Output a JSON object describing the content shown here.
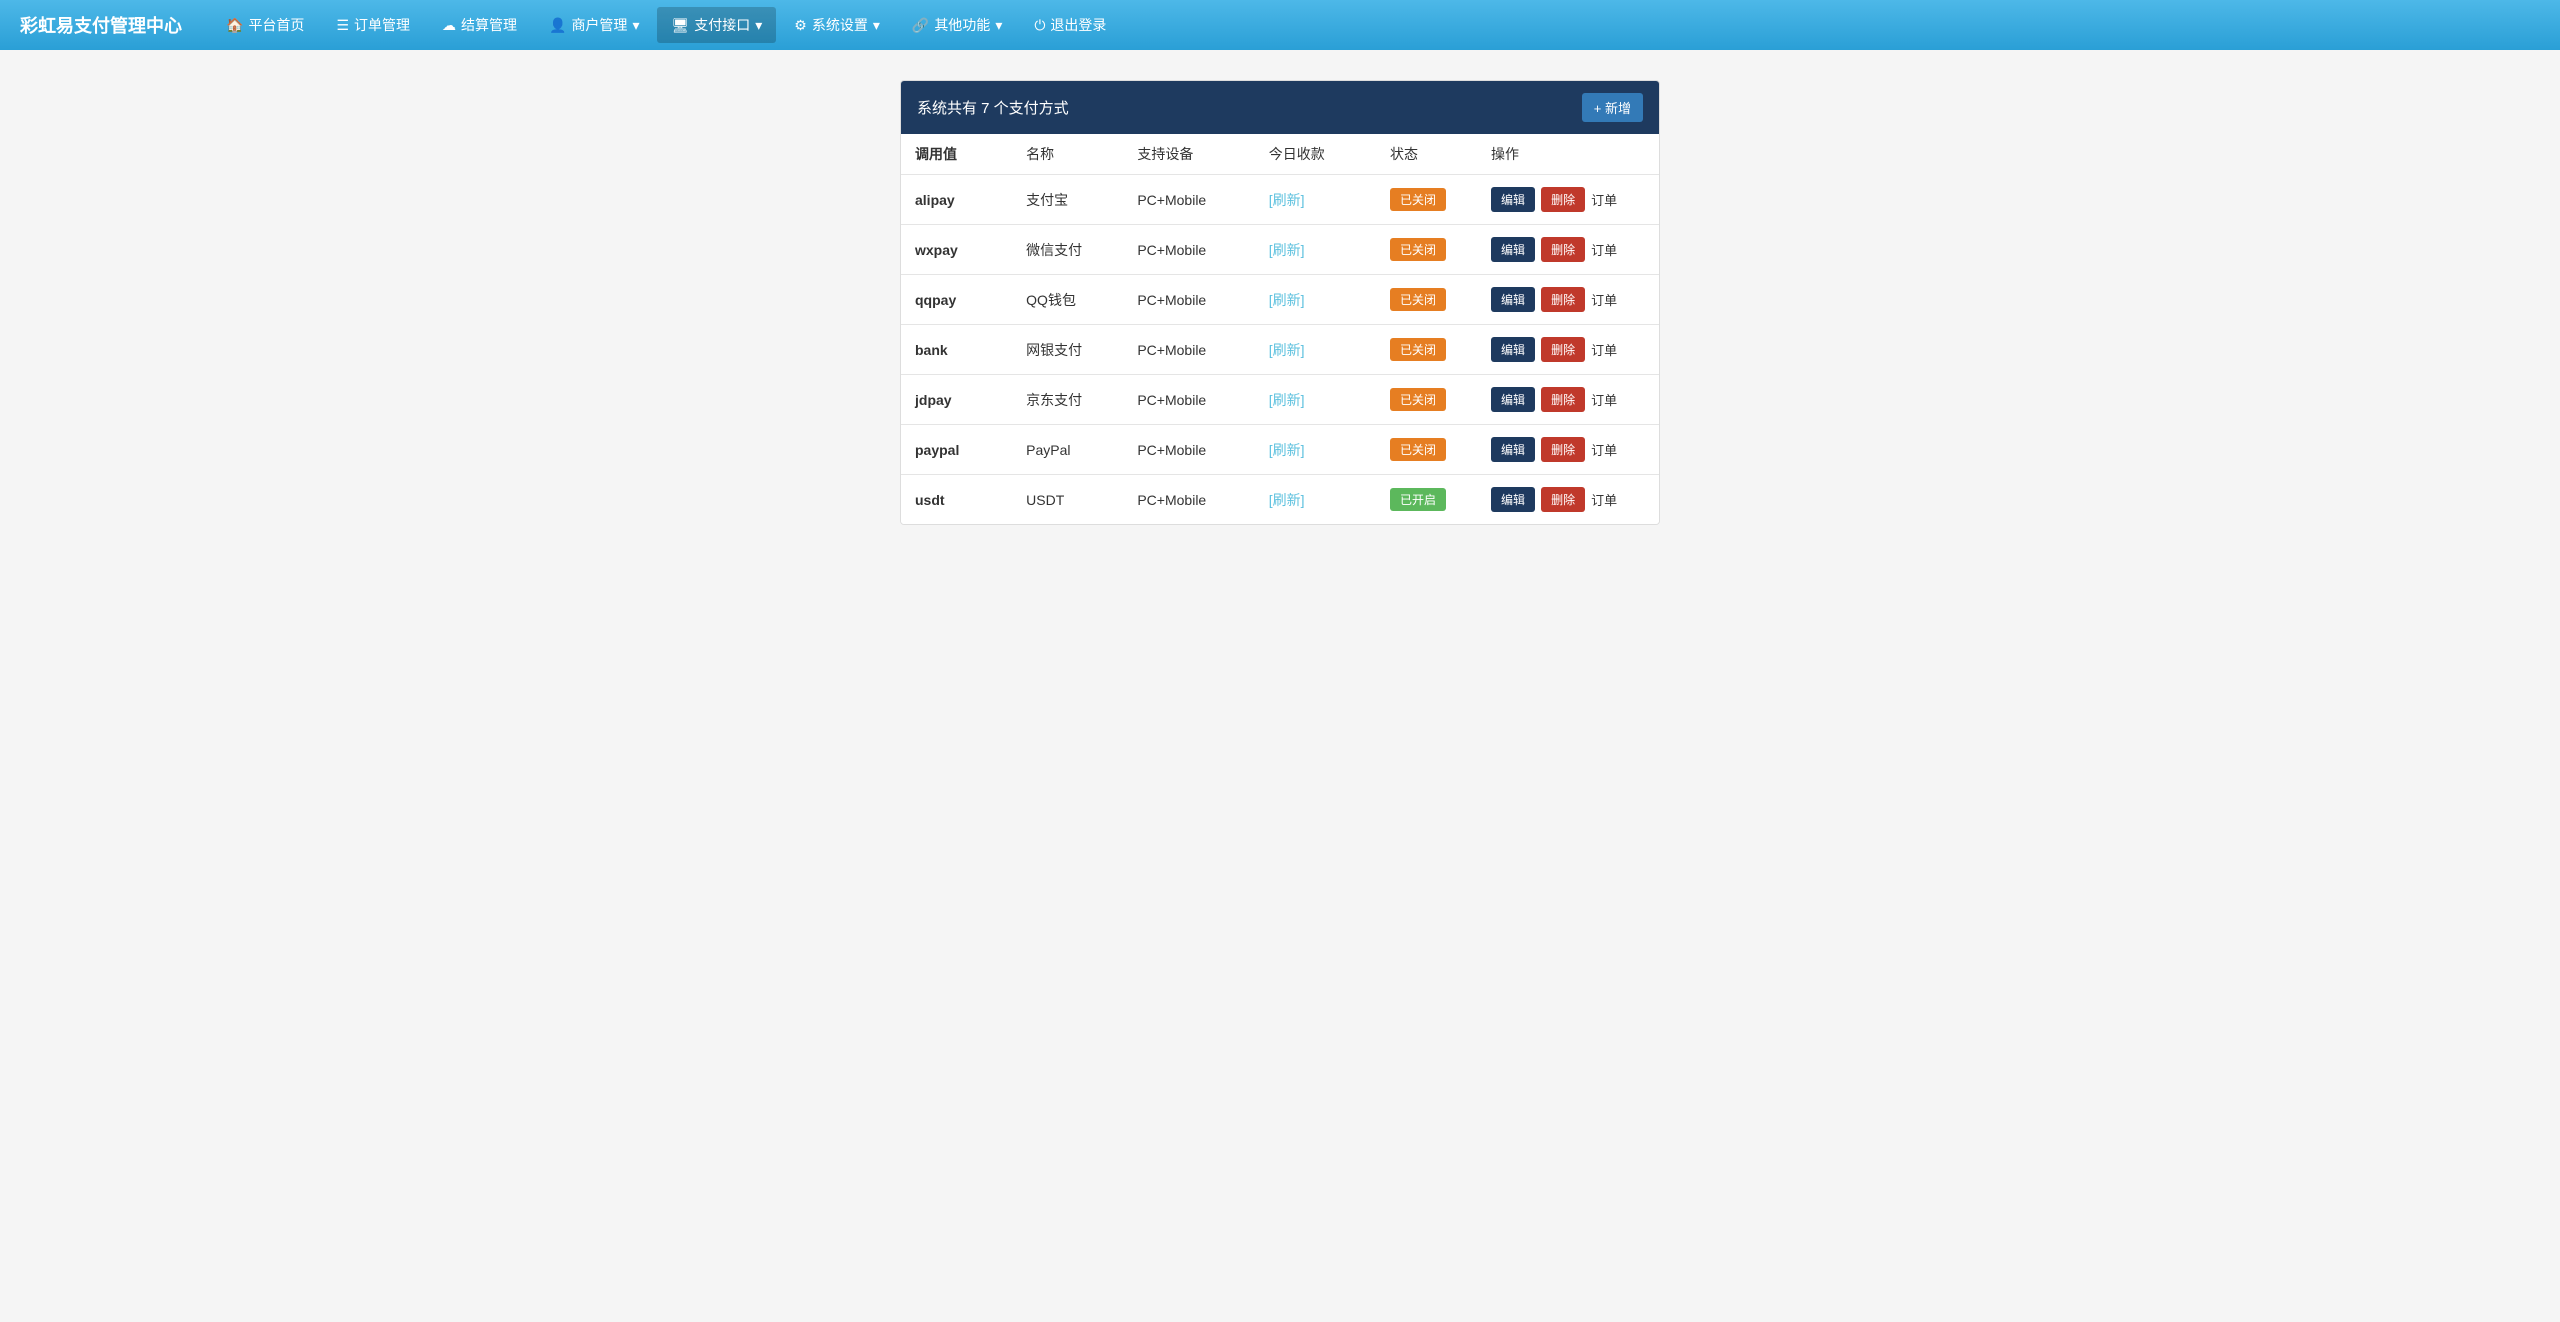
{
  "app": {
    "title": "彩虹易支付管理中心"
  },
  "navbar": {
    "brand": "彩虹易支付管理中心",
    "items": [
      {
        "id": "home",
        "icon": "🏠",
        "label": "平台首页",
        "active": false
      },
      {
        "id": "orders",
        "icon": "📋",
        "label": "订单管理",
        "active": false
      },
      {
        "id": "settlement",
        "icon": "☁",
        "label": "结算管理",
        "active": false
      },
      {
        "id": "merchant",
        "icon": "👤",
        "label": "商户管理",
        "active": false,
        "dropdown": true
      },
      {
        "id": "payment",
        "icon": "🖥",
        "label": "支付接口",
        "active": true,
        "dropdown": true
      },
      {
        "id": "settings",
        "icon": "⚙",
        "label": "系统设置",
        "active": false,
        "dropdown": true
      },
      {
        "id": "other",
        "icon": "🔗",
        "label": "其他功能",
        "active": false,
        "dropdown": true
      },
      {
        "id": "logout",
        "icon": "⏻",
        "label": "退出登录",
        "active": false
      }
    ]
  },
  "panel": {
    "title": "系统共有 7 个支付方式",
    "new_button_label": "+ 新增"
  },
  "table": {
    "headers": [
      "调用值",
      "名称",
      "支持设备",
      "今日收款",
      "状态",
      "操作"
    ],
    "rows": [
      {
        "key": "alipay",
        "name": "支付宝",
        "device": "PC+Mobile",
        "today_link": "[刷新]",
        "status": "已关闭",
        "status_type": "closed"
      },
      {
        "key": "wxpay",
        "name": "微信支付",
        "device": "PC+Mobile",
        "today_link": "[刷新]",
        "status": "已关闭",
        "status_type": "closed"
      },
      {
        "key": "qqpay",
        "name": "QQ钱包",
        "device": "PC+Mobile",
        "today_link": "[刷新]",
        "status": "已关闭",
        "status_type": "closed"
      },
      {
        "key": "bank",
        "name": "网银支付",
        "device": "PC+Mobile",
        "today_link": "[刷新]",
        "status": "已关闭",
        "status_type": "closed"
      },
      {
        "key": "jdpay",
        "name": "京东支付",
        "device": "PC+Mobile",
        "today_link": "[刷新]",
        "status": "已关闭",
        "status_type": "closed"
      },
      {
        "key": "paypal",
        "name": "PayPal",
        "device": "PC+Mobile",
        "today_link": "[刷新]",
        "status": "已关闭",
        "status_type": "closed"
      },
      {
        "key": "usdt",
        "name": "USDT",
        "device": "PC+Mobile",
        "today_link": "[刷新]",
        "status": "已开启",
        "status_type": "open"
      }
    ],
    "btn_edit": "编辑",
    "btn_delete": "删除",
    "btn_order": "订单"
  }
}
